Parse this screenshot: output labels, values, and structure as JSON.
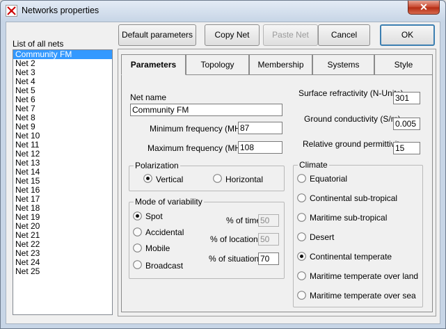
{
  "window": {
    "title": "Networks properties",
    "close_glyph": "✕"
  },
  "list": {
    "label": "List of all nets",
    "items": [
      "Community FM",
      "Net  2",
      "Net  3",
      "Net  4",
      "Net  5",
      "Net  6",
      "Net  7",
      "Net  8",
      "Net  9",
      "Net 10",
      "Net 11",
      "Net 12",
      "Net 13",
      "Net 14",
      "Net 15",
      "Net 16",
      "Net 17",
      "Net 18",
      "Net 19",
      "Net 20",
      "Net 21",
      "Net 22",
      "Net 23",
      "Net 24",
      "Net 25"
    ],
    "selected_index": 0
  },
  "buttons": {
    "default_parameters": "Default parameters",
    "copy_net": "Copy Net",
    "paste_net": "Paste Net",
    "cancel": "Cancel",
    "ok": "OK"
  },
  "tabs": [
    "Parameters",
    "Topology",
    "Membership",
    "Systems",
    "Style"
  ],
  "active_tab": 0,
  "params": {
    "net_name_label": "Net name",
    "net_name": "Community FM",
    "min_freq_label": "Minimum frequency (MHz)",
    "min_freq": "87",
    "max_freq_label": "Maximum frequency (MHz)",
    "max_freq": "108",
    "surface_refr_label": "Surface refractivity (N-Units)",
    "surface_refr": "301",
    "ground_cond_label": "Ground conductivity (S/m)",
    "ground_cond": "0.005",
    "rel_perm_label": "Relative ground permittivity",
    "rel_perm": "15"
  },
  "polarization": {
    "label": "Polarization",
    "options": [
      "Vertical",
      "Horizontal"
    ],
    "selected": 0
  },
  "variability": {
    "label": "Mode of variability",
    "options": [
      "Spot",
      "Accidental",
      "Mobile",
      "Broadcast"
    ],
    "selected": 0,
    "time_label": "% of time",
    "time": "50",
    "locations_label": "% of locations",
    "locations": "50",
    "situations_label": "% of situations",
    "situations": "70"
  },
  "climate": {
    "label": "Climate",
    "options": [
      "Equatorial",
      "Continental sub-tropical",
      "Maritime sub-tropical",
      "Desert",
      "Continental temperate",
      "Maritime temperate over land",
      "Maritime temperate over sea"
    ],
    "selected": 4
  }
}
